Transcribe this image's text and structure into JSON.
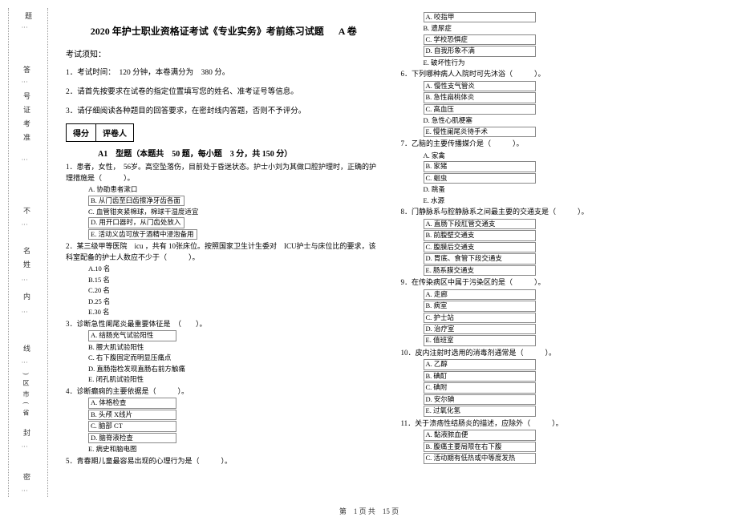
{
  "gutter": {
    "top_char": "题",
    "labels": [
      "答",
      "号 证 考 准",
      "不",
      "名 姓",
      "内",
      "线",
      ") 区 市 ( 省",
      "封",
      "密"
    ]
  },
  "header": {
    "title": "2020 年护士职业资格证考试《专业实务》考前练习试题",
    "volume": "A 卷"
  },
  "notice": {
    "title": "考试须知：",
    "items": [
      "1．考试时间：　120 分钟，本卷满分为　380 分。",
      "2．请首先按要求在试卷的指定位置填写您的姓名、准考证号等信息。",
      "3．请仔细阅读各种题目的回答要求，在密封线内答题，否则不予评分。"
    ]
  },
  "score_box": [
    "得分",
    "评卷人"
  ],
  "section": "A1　型题（本题共　50 题，每小题　3 分，共 150 分）",
  "col1_questions": [
    {
      "num": "1．",
      "text": "患者，女性，　56岁。高空坠落伤，目前处于昏迷状态。护士小刘为其做口腔护理时，正确的护理措施是（　　　）。",
      "options": [
        {
          "t": "A. 协助患者漱口",
          "box": false
        },
        {
          "t": "B. 从门齿至臼齿擦净牙齿各面",
          "box": true
        },
        {
          "t": "C. 血管钳夹紧棉球，棉球干湿度适宜",
          "box": false
        },
        {
          "t": "D. 用开口器时，从门齿处放入",
          "box": true
        },
        {
          "t": "E. 活动义齿可放于酒精中浸泡备用",
          "box": true
        }
      ]
    },
    {
      "num": "2．",
      "text": "某三级甲等医院　icu ，共有 10张床位。按照国家卫生计生委对　ICU护士与床位比的要求，该科室配备的护士人数应不少于（　　　）。",
      "options": [
        {
          "t": "A.10 名",
          "box": false
        },
        {
          "t": "B.15 名",
          "box": false
        },
        {
          "t": "C.20 名",
          "box": false
        },
        {
          "t": "D.25 名",
          "box": false
        },
        {
          "t": "E.30 名",
          "box": false
        }
      ]
    },
    {
      "num": "3．",
      "text": "诊断急性阑尾炎最重要体征是　（　　）。",
      "options": [
        {
          "t": "A. 结肠充气试验阳性",
          "box": true
        },
        {
          "t": "B. 腰大肌试验阳性",
          "box": false
        },
        {
          "t": "C. 右下腹固定而明显压痛点",
          "box": false
        },
        {
          "t": "D. 直肠指检发现直肠右前方触痛",
          "box": false
        },
        {
          "t": "E. 闭孔肌试验阳性",
          "box": false
        }
      ]
    },
    {
      "num": "4．",
      "text": "诊断癫痫的主要依据是（　　　）。",
      "options": [
        {
          "t": "A. 体格检查",
          "box": true
        },
        {
          "t": "B. 头颅 X线片",
          "box": true
        },
        {
          "t": "C. 脑部 CT",
          "box": true
        },
        {
          "t": "D. 脑脊液检查",
          "box": true
        },
        {
          "t": "E. 病史和脑电图",
          "box": false
        }
      ]
    },
    {
      "num": "5．",
      "text": "青春期儿童最容易出现的心理行为是（　　　）。",
      "options": []
    }
  ],
  "col2_questions": [
    {
      "num": "",
      "text": "",
      "options": [
        {
          "t": "A. 咬指甲",
          "box": true
        },
        {
          "t": "B. 遗尿症",
          "box": false
        },
        {
          "t": "C. 学校恐惧症",
          "box": true
        },
        {
          "t": "D. 自我形象不满",
          "box": true
        },
        {
          "t": "E. 破坏性行为",
          "box": false
        }
      ]
    },
    {
      "num": "6．",
      "text": "下列哪种病人入院时可先沐浴（　　　）。",
      "options": [
        {
          "t": "A. 慢性支气管炎",
          "box": true
        },
        {
          "t": "B. 急性扁桃体炎",
          "box": true
        },
        {
          "t": "C. 高血压",
          "box": true
        },
        {
          "t": "D. 急性心肌梗塞",
          "box": false
        },
        {
          "t": "E. 慢性阑尾炎待手术",
          "box": true
        }
      ]
    },
    {
      "num": "7．",
      "text": "乙脑的主要传播媒介是（　　　）。",
      "options": [
        {
          "t": "A. 家禽",
          "box": false
        },
        {
          "t": "B. 家猪",
          "box": true
        },
        {
          "t": "C. 蛔虫",
          "box": true
        },
        {
          "t": "D. 跳蚤",
          "box": false
        },
        {
          "t": "E. 水源",
          "box": false
        }
      ]
    },
    {
      "num": "8．",
      "text": "门静脉系与腔静脉系之间最主要的交通支是（　　　）。",
      "options": [
        {
          "t": "A. 直肠下段肛管交通支",
          "box": true
        },
        {
          "t": "B. 前腹壁交通支",
          "box": true
        },
        {
          "t": "C. 腹膜后交通支",
          "box": true
        },
        {
          "t": "D. 胃底、食管下段交通支",
          "box": true
        },
        {
          "t": "E. 肠系膜交通支",
          "box": true
        }
      ]
    },
    {
      "num": "9．",
      "text": "在传染病区中属于污染区的是（　　　）。",
      "options": [
        {
          "t": "A. 走廊",
          "box": true
        },
        {
          "t": "B. 病室",
          "box": true
        },
        {
          "t": "C. 护士站",
          "box": true
        },
        {
          "t": "D. 治疗室",
          "box": true
        },
        {
          "t": "E. 值班室",
          "box": true
        }
      ]
    },
    {
      "num": "10．",
      "text": "皮内注射时选用的消毒剂通常是（　　　）。",
      "options": [
        {
          "t": "A. 乙醇",
          "box": true
        },
        {
          "t": "B. 碘酊",
          "box": true
        },
        {
          "t": "C. 碘附",
          "box": true
        },
        {
          "t": "D. 安尔碘",
          "box": true
        },
        {
          "t": "E. 过氧化氢",
          "box": true
        }
      ]
    },
    {
      "num": "11．",
      "text": "关于溃疡性结肠炎的描述，应除外（　　　）。",
      "options": [
        {
          "t": "A. 黏液脓血便",
          "box": true
        },
        {
          "t": "B. 腹痛主要局限在右下腹",
          "box": true
        },
        {
          "t": "C. 活动期有低热或中等度发热",
          "box": true
        }
      ]
    }
  ],
  "footer": "第　1 页 共　15 页"
}
